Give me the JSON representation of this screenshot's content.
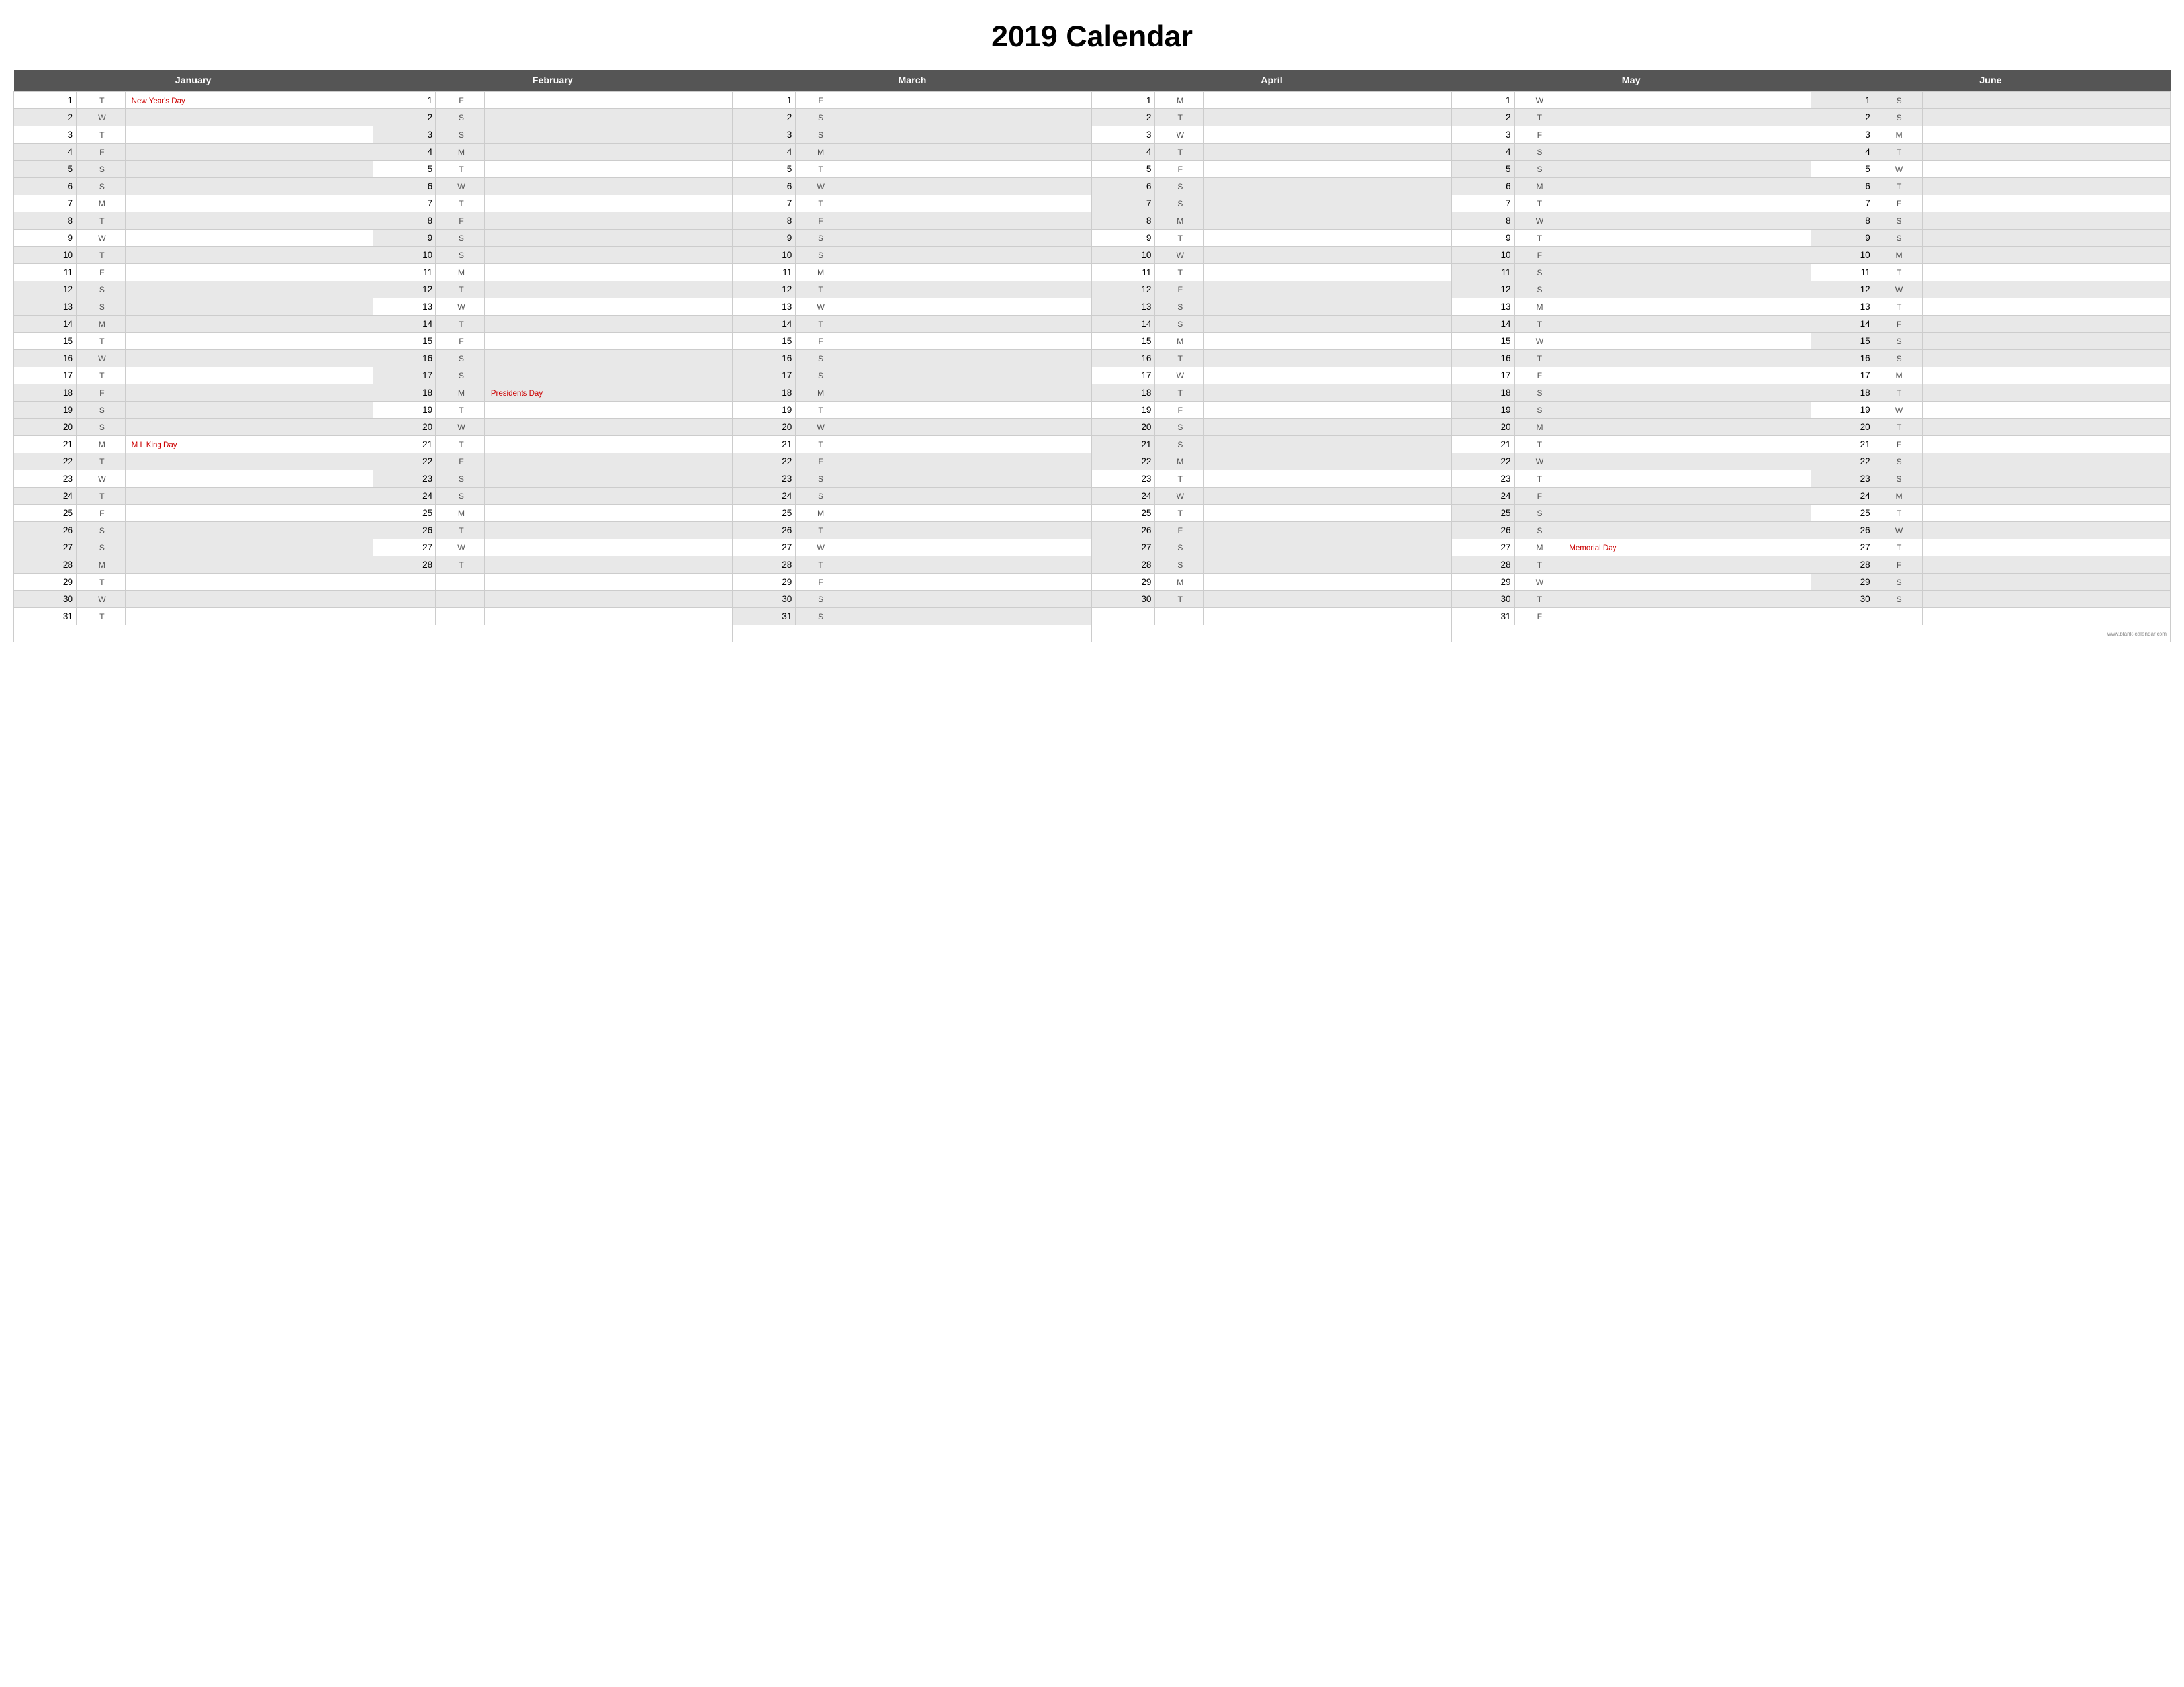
{
  "title": "2019 Calendar",
  "months": [
    "January",
    "February",
    "March",
    "April",
    "May",
    "June"
  ],
  "footer_url": "www.blank-calendar.com",
  "days": {
    "january": [
      {
        "n": 1,
        "d": "T",
        "h": "New Year's Day"
      },
      {
        "n": 2,
        "d": "W",
        "h": ""
      },
      {
        "n": 3,
        "d": "T",
        "h": ""
      },
      {
        "n": 4,
        "d": "F",
        "h": ""
      },
      {
        "n": 5,
        "d": "S",
        "h": ""
      },
      {
        "n": 6,
        "d": "S",
        "h": ""
      },
      {
        "n": 7,
        "d": "M",
        "h": ""
      },
      {
        "n": 8,
        "d": "T",
        "h": ""
      },
      {
        "n": 9,
        "d": "W",
        "h": ""
      },
      {
        "n": 10,
        "d": "T",
        "h": ""
      },
      {
        "n": 11,
        "d": "F",
        "h": ""
      },
      {
        "n": 12,
        "d": "S",
        "h": ""
      },
      {
        "n": 13,
        "d": "S",
        "h": ""
      },
      {
        "n": 14,
        "d": "M",
        "h": ""
      },
      {
        "n": 15,
        "d": "T",
        "h": ""
      },
      {
        "n": 16,
        "d": "W",
        "h": ""
      },
      {
        "n": 17,
        "d": "T",
        "h": ""
      },
      {
        "n": 18,
        "d": "F",
        "h": ""
      },
      {
        "n": 19,
        "d": "S",
        "h": ""
      },
      {
        "n": 20,
        "d": "S",
        "h": ""
      },
      {
        "n": 21,
        "d": "M",
        "h": "M L King Day"
      },
      {
        "n": 22,
        "d": "T",
        "h": ""
      },
      {
        "n": 23,
        "d": "W",
        "h": ""
      },
      {
        "n": 24,
        "d": "T",
        "h": ""
      },
      {
        "n": 25,
        "d": "F",
        "h": ""
      },
      {
        "n": 26,
        "d": "S",
        "h": ""
      },
      {
        "n": 27,
        "d": "S",
        "h": ""
      },
      {
        "n": 28,
        "d": "M",
        "h": ""
      },
      {
        "n": 29,
        "d": "T",
        "h": ""
      },
      {
        "n": 30,
        "d": "W",
        "h": ""
      },
      {
        "n": 31,
        "d": "T",
        "h": ""
      }
    ],
    "february": [
      {
        "n": 1,
        "d": "F",
        "h": ""
      },
      {
        "n": 2,
        "d": "S",
        "h": ""
      },
      {
        "n": 3,
        "d": "S",
        "h": ""
      },
      {
        "n": 4,
        "d": "M",
        "h": ""
      },
      {
        "n": 5,
        "d": "T",
        "h": ""
      },
      {
        "n": 6,
        "d": "W",
        "h": ""
      },
      {
        "n": 7,
        "d": "T",
        "h": ""
      },
      {
        "n": 8,
        "d": "F",
        "h": ""
      },
      {
        "n": 9,
        "d": "S",
        "h": ""
      },
      {
        "n": 10,
        "d": "S",
        "h": ""
      },
      {
        "n": 11,
        "d": "M",
        "h": ""
      },
      {
        "n": 12,
        "d": "T",
        "h": ""
      },
      {
        "n": 13,
        "d": "W",
        "h": ""
      },
      {
        "n": 14,
        "d": "T",
        "h": ""
      },
      {
        "n": 15,
        "d": "F",
        "h": ""
      },
      {
        "n": 16,
        "d": "S",
        "h": ""
      },
      {
        "n": 17,
        "d": "S",
        "h": ""
      },
      {
        "n": 18,
        "d": "M",
        "h": "Presidents Day"
      },
      {
        "n": 19,
        "d": "T",
        "h": ""
      },
      {
        "n": 20,
        "d": "W",
        "h": ""
      },
      {
        "n": 21,
        "d": "T",
        "h": ""
      },
      {
        "n": 22,
        "d": "F",
        "h": ""
      },
      {
        "n": 23,
        "d": "S",
        "h": ""
      },
      {
        "n": 24,
        "d": "S",
        "h": ""
      },
      {
        "n": 25,
        "d": "M",
        "h": ""
      },
      {
        "n": 26,
        "d": "T",
        "h": ""
      },
      {
        "n": 27,
        "d": "W",
        "h": ""
      },
      {
        "n": 28,
        "d": "T",
        "h": ""
      },
      {
        "n": null,
        "d": "",
        "h": ""
      },
      {
        "n": null,
        "d": "",
        "h": ""
      },
      {
        "n": null,
        "d": "",
        "h": ""
      }
    ],
    "march": [
      {
        "n": 1,
        "d": "F",
        "h": ""
      },
      {
        "n": 2,
        "d": "S",
        "h": ""
      },
      {
        "n": 3,
        "d": "S",
        "h": ""
      },
      {
        "n": 4,
        "d": "M",
        "h": ""
      },
      {
        "n": 5,
        "d": "T",
        "h": ""
      },
      {
        "n": 6,
        "d": "W",
        "h": ""
      },
      {
        "n": 7,
        "d": "T",
        "h": ""
      },
      {
        "n": 8,
        "d": "F",
        "h": ""
      },
      {
        "n": 9,
        "d": "S",
        "h": ""
      },
      {
        "n": 10,
        "d": "S",
        "h": ""
      },
      {
        "n": 11,
        "d": "M",
        "h": ""
      },
      {
        "n": 12,
        "d": "T",
        "h": ""
      },
      {
        "n": 13,
        "d": "W",
        "h": ""
      },
      {
        "n": 14,
        "d": "T",
        "h": ""
      },
      {
        "n": 15,
        "d": "F",
        "h": ""
      },
      {
        "n": 16,
        "d": "S",
        "h": ""
      },
      {
        "n": 17,
        "d": "S",
        "h": ""
      },
      {
        "n": 18,
        "d": "M",
        "h": ""
      },
      {
        "n": 19,
        "d": "T",
        "h": ""
      },
      {
        "n": 20,
        "d": "W",
        "h": ""
      },
      {
        "n": 21,
        "d": "T",
        "h": ""
      },
      {
        "n": 22,
        "d": "F",
        "h": ""
      },
      {
        "n": 23,
        "d": "S",
        "h": ""
      },
      {
        "n": 24,
        "d": "S",
        "h": ""
      },
      {
        "n": 25,
        "d": "M",
        "h": ""
      },
      {
        "n": 26,
        "d": "T",
        "h": ""
      },
      {
        "n": 27,
        "d": "W",
        "h": ""
      },
      {
        "n": 28,
        "d": "T",
        "h": ""
      },
      {
        "n": 29,
        "d": "F",
        "h": ""
      },
      {
        "n": 30,
        "d": "S",
        "h": ""
      },
      {
        "n": 31,
        "d": "S",
        "h": ""
      }
    ],
    "april": [
      {
        "n": 1,
        "d": "M",
        "h": ""
      },
      {
        "n": 2,
        "d": "T",
        "h": ""
      },
      {
        "n": 3,
        "d": "W",
        "h": ""
      },
      {
        "n": 4,
        "d": "T",
        "h": ""
      },
      {
        "n": 5,
        "d": "F",
        "h": ""
      },
      {
        "n": 6,
        "d": "S",
        "h": ""
      },
      {
        "n": 7,
        "d": "S",
        "h": ""
      },
      {
        "n": 8,
        "d": "M",
        "h": ""
      },
      {
        "n": 9,
        "d": "T",
        "h": ""
      },
      {
        "n": 10,
        "d": "W",
        "h": ""
      },
      {
        "n": 11,
        "d": "T",
        "h": ""
      },
      {
        "n": 12,
        "d": "F",
        "h": ""
      },
      {
        "n": 13,
        "d": "S",
        "h": ""
      },
      {
        "n": 14,
        "d": "S",
        "h": ""
      },
      {
        "n": 15,
        "d": "M",
        "h": ""
      },
      {
        "n": 16,
        "d": "T",
        "h": ""
      },
      {
        "n": 17,
        "d": "W",
        "h": ""
      },
      {
        "n": 18,
        "d": "T",
        "h": ""
      },
      {
        "n": 19,
        "d": "F",
        "h": ""
      },
      {
        "n": 20,
        "d": "S",
        "h": ""
      },
      {
        "n": 21,
        "d": "S",
        "h": ""
      },
      {
        "n": 22,
        "d": "M",
        "h": ""
      },
      {
        "n": 23,
        "d": "T",
        "h": ""
      },
      {
        "n": 24,
        "d": "W",
        "h": ""
      },
      {
        "n": 25,
        "d": "T",
        "h": ""
      },
      {
        "n": 26,
        "d": "F",
        "h": ""
      },
      {
        "n": 27,
        "d": "S",
        "h": ""
      },
      {
        "n": 28,
        "d": "S",
        "h": ""
      },
      {
        "n": 29,
        "d": "M",
        "h": ""
      },
      {
        "n": 30,
        "d": "T",
        "h": ""
      },
      {
        "n": null,
        "d": "",
        "h": ""
      }
    ],
    "may": [
      {
        "n": 1,
        "d": "W",
        "h": ""
      },
      {
        "n": 2,
        "d": "T",
        "h": ""
      },
      {
        "n": 3,
        "d": "F",
        "h": ""
      },
      {
        "n": 4,
        "d": "S",
        "h": ""
      },
      {
        "n": 5,
        "d": "S",
        "h": ""
      },
      {
        "n": 6,
        "d": "M",
        "h": ""
      },
      {
        "n": 7,
        "d": "T",
        "h": ""
      },
      {
        "n": 8,
        "d": "W",
        "h": ""
      },
      {
        "n": 9,
        "d": "T",
        "h": ""
      },
      {
        "n": 10,
        "d": "F",
        "h": ""
      },
      {
        "n": 11,
        "d": "S",
        "h": ""
      },
      {
        "n": 12,
        "d": "S",
        "h": ""
      },
      {
        "n": 13,
        "d": "M",
        "h": ""
      },
      {
        "n": 14,
        "d": "T",
        "h": ""
      },
      {
        "n": 15,
        "d": "W",
        "h": ""
      },
      {
        "n": 16,
        "d": "T",
        "h": ""
      },
      {
        "n": 17,
        "d": "F",
        "h": ""
      },
      {
        "n": 18,
        "d": "S",
        "h": ""
      },
      {
        "n": 19,
        "d": "S",
        "h": ""
      },
      {
        "n": 20,
        "d": "M",
        "h": ""
      },
      {
        "n": 21,
        "d": "T",
        "h": ""
      },
      {
        "n": 22,
        "d": "W",
        "h": ""
      },
      {
        "n": 23,
        "d": "T",
        "h": ""
      },
      {
        "n": 24,
        "d": "F",
        "h": ""
      },
      {
        "n": 25,
        "d": "S",
        "h": ""
      },
      {
        "n": 26,
        "d": "S",
        "h": ""
      },
      {
        "n": 27,
        "d": "M",
        "h": "Memorial Day"
      },
      {
        "n": 28,
        "d": "T",
        "h": ""
      },
      {
        "n": 29,
        "d": "W",
        "h": ""
      },
      {
        "n": 30,
        "d": "T",
        "h": ""
      },
      {
        "n": 31,
        "d": "F",
        "h": ""
      }
    ],
    "june": [
      {
        "n": 1,
        "d": "S",
        "h": ""
      },
      {
        "n": 2,
        "d": "S",
        "h": ""
      },
      {
        "n": 3,
        "d": "M",
        "h": ""
      },
      {
        "n": 4,
        "d": "T",
        "h": ""
      },
      {
        "n": 5,
        "d": "W",
        "h": ""
      },
      {
        "n": 6,
        "d": "T",
        "h": ""
      },
      {
        "n": 7,
        "d": "F",
        "h": ""
      },
      {
        "n": 8,
        "d": "S",
        "h": ""
      },
      {
        "n": 9,
        "d": "S",
        "h": ""
      },
      {
        "n": 10,
        "d": "M",
        "h": ""
      },
      {
        "n": 11,
        "d": "T",
        "h": ""
      },
      {
        "n": 12,
        "d": "W",
        "h": ""
      },
      {
        "n": 13,
        "d": "T",
        "h": ""
      },
      {
        "n": 14,
        "d": "F",
        "h": ""
      },
      {
        "n": 15,
        "d": "S",
        "h": ""
      },
      {
        "n": 16,
        "d": "S",
        "h": ""
      },
      {
        "n": 17,
        "d": "M",
        "h": ""
      },
      {
        "n": 18,
        "d": "T",
        "h": ""
      },
      {
        "n": 19,
        "d": "W",
        "h": ""
      },
      {
        "n": 20,
        "d": "T",
        "h": ""
      },
      {
        "n": 21,
        "d": "F",
        "h": ""
      },
      {
        "n": 22,
        "d": "S",
        "h": ""
      },
      {
        "n": 23,
        "d": "S",
        "h": ""
      },
      {
        "n": 24,
        "d": "M",
        "h": ""
      },
      {
        "n": 25,
        "d": "T",
        "h": ""
      },
      {
        "n": 26,
        "d": "W",
        "h": ""
      },
      {
        "n": 27,
        "d": "T",
        "h": ""
      },
      {
        "n": 28,
        "d": "F",
        "h": ""
      },
      {
        "n": 29,
        "d": "S",
        "h": ""
      },
      {
        "n": 30,
        "d": "S",
        "h": ""
      },
      {
        "n": null,
        "d": "",
        "h": ""
      }
    ]
  }
}
